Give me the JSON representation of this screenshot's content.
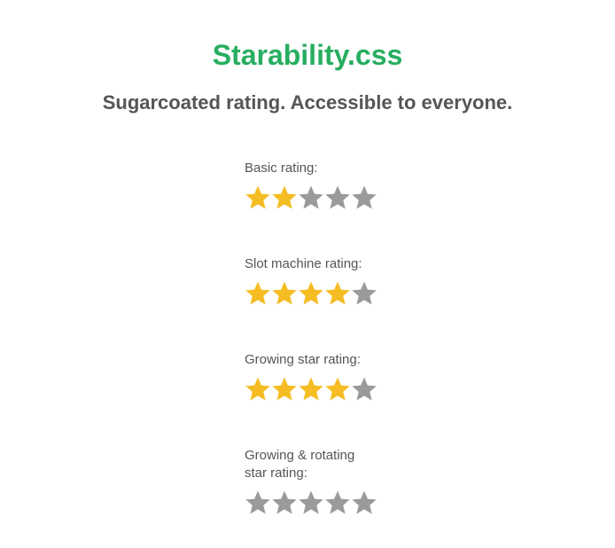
{
  "header": {
    "title": "Starability.css",
    "subtitle": "Sugarcoated rating. Accessible to everyone."
  },
  "colors": {
    "title": "#27ae60",
    "star_filled": "#f5bd23",
    "star_empty": "#9a9a9a"
  },
  "ratings": [
    {
      "label": "Basic rating:",
      "value": 2,
      "max": 5
    },
    {
      "label": "Slot machine rating:",
      "value": 4,
      "max": 5
    },
    {
      "label": "Growing star rating:",
      "value": 4,
      "max": 5
    },
    {
      "label": "Growing & rotating\nstar rating:",
      "value": 0,
      "max": 5
    }
  ]
}
